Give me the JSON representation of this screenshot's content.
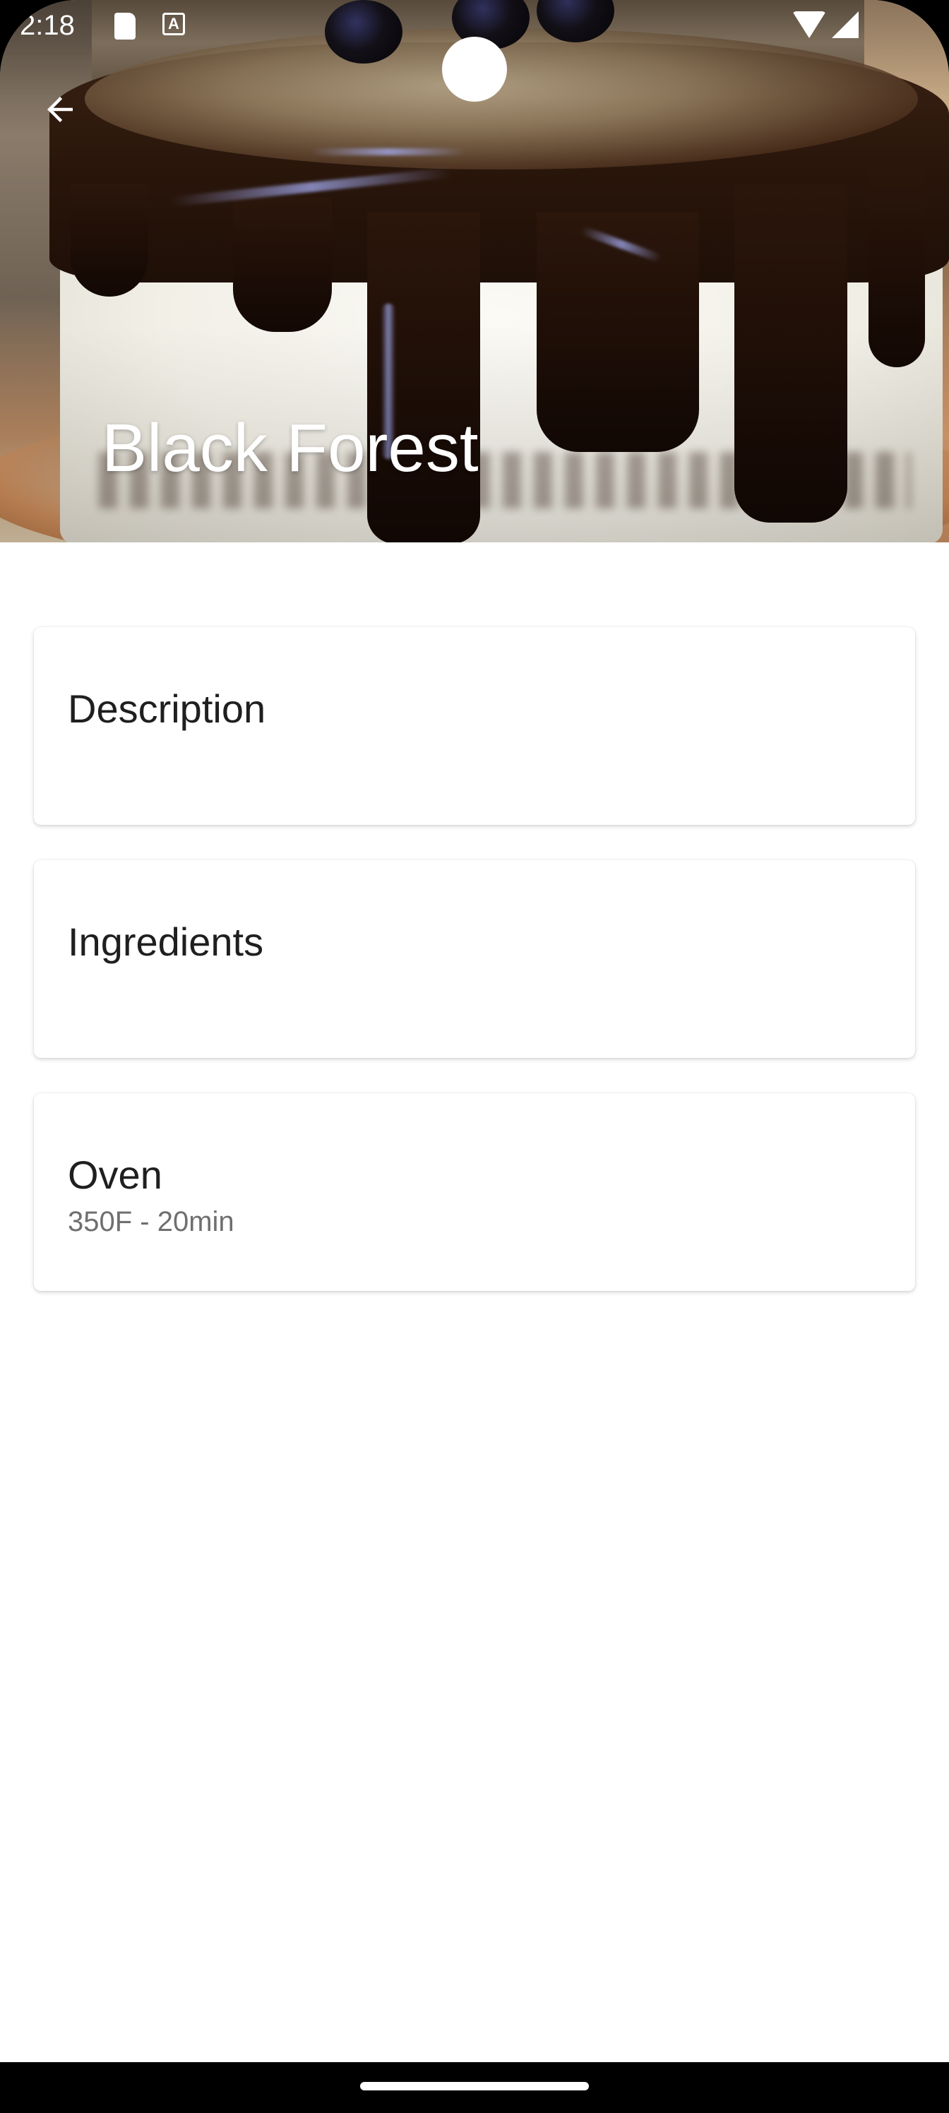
{
  "status_bar": {
    "time": "2:18",
    "icons": [
      "sd-card-icon",
      "text-recognition-icon",
      "wifi-icon",
      "cell-signal-icon"
    ]
  },
  "header": {
    "title": "Black Forest",
    "back_icon": "arrow-back-icon"
  },
  "cards": [
    {
      "title": "Description",
      "subtitle": ""
    },
    {
      "title": "Ingredients",
      "subtitle": ""
    },
    {
      "title": "Oven",
      "subtitle": "350F - 20min"
    }
  ],
  "colors": {
    "background": "#ffffff",
    "title_text": "#ffffff",
    "card_title": "#1f1f1f",
    "card_subtitle": "#6f6f6f"
  }
}
